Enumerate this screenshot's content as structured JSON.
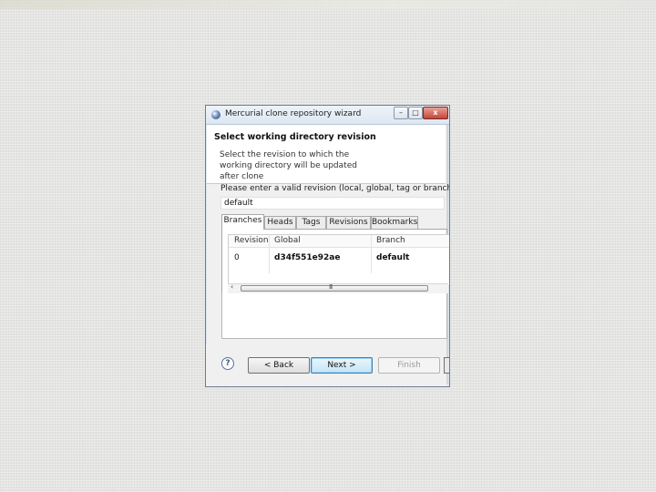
{
  "window": {
    "title": "Mercurial clone repository wizard",
    "controls": {
      "minimize": "–",
      "maximize": "□",
      "close": "x"
    }
  },
  "header": {
    "title": "Select working directory revision",
    "description": "Select the revision to which the working directory will be updated after clone"
  },
  "revision": {
    "prompt": "Please enter a valid revision (local, global, tag or branch):",
    "value": "default"
  },
  "tabs": [
    {
      "label": "Branches",
      "active": true
    },
    {
      "label": "Heads"
    },
    {
      "label": "Tags"
    },
    {
      "label": "Revisions"
    },
    {
      "label": "Bookmarks"
    }
  ],
  "table": {
    "columns": [
      "Revision",
      "Global",
      "Branch"
    ],
    "rows": [
      {
        "revision": "0",
        "global": "d34f551e92ae",
        "branch": "default"
      }
    ]
  },
  "scrollbar": {
    "left_arrow": "‹",
    "grip": "III"
  },
  "buttons": {
    "help": "?",
    "back": "< Back",
    "next": "Next >",
    "finish": "Finish"
  }
}
